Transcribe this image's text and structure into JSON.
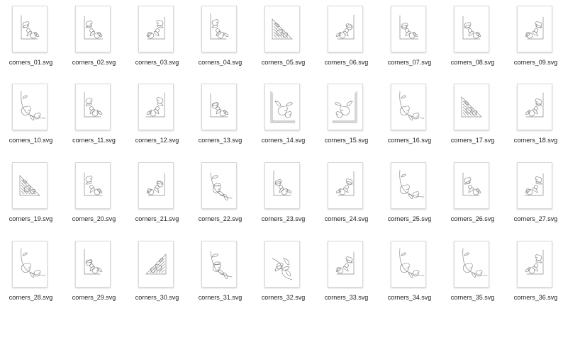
{
  "files": [
    {
      "name": "corners_01.svg",
      "icon": "floral-corner-ornament-icon"
    },
    {
      "name": "corners_02.svg",
      "icon": "floral-corner-ornament-icon"
    },
    {
      "name": "corners_03.svg",
      "icon": "floral-corner-ornament-icon"
    },
    {
      "name": "corners_04.svg",
      "icon": "floral-corner-ornament-icon"
    },
    {
      "name": "corners_05.svg",
      "icon": "lace-triangle-corner-icon"
    },
    {
      "name": "corners_06.svg",
      "icon": "floral-corner-ornament-icon"
    },
    {
      "name": "corners_07.svg",
      "icon": "floral-corner-ornament-icon"
    },
    {
      "name": "corners_08.svg",
      "icon": "floral-corner-ornament-icon"
    },
    {
      "name": "corners_09.svg",
      "icon": "floral-corner-ornament-icon"
    },
    {
      "name": "corners_10.svg",
      "icon": "scroll-corner-ornament-icon"
    },
    {
      "name": "corners_11.svg",
      "icon": "floral-corner-ornament-icon"
    },
    {
      "name": "corners_12.svg",
      "icon": "floral-corner-ornament-icon"
    },
    {
      "name": "corners_13.svg",
      "icon": "floral-corner-ornament-icon"
    },
    {
      "name": "corners_14.svg",
      "icon": "framed-corner-ornament-icon"
    },
    {
      "name": "corners_15.svg",
      "icon": "framed-corner-ornament-icon"
    },
    {
      "name": "corners_16.svg",
      "icon": "scroll-corner-ornament-icon"
    },
    {
      "name": "corners_17.svg",
      "icon": "lace-triangle-corner-icon"
    },
    {
      "name": "corners_18.svg",
      "icon": "floral-corner-ornament-icon"
    },
    {
      "name": "corners_19.svg",
      "icon": "lace-triangle-corner-icon"
    },
    {
      "name": "corners_20.svg",
      "icon": "floral-corner-ornament-icon"
    },
    {
      "name": "corners_21.svg",
      "icon": "floral-corner-ornament-icon"
    },
    {
      "name": "corners_22.svg",
      "icon": "acanthus-corner-ornament-icon"
    },
    {
      "name": "corners_23.svg",
      "icon": "floral-corner-ornament-icon"
    },
    {
      "name": "corners_24.svg",
      "icon": "floral-corner-ornament-icon"
    },
    {
      "name": "corners_25.svg",
      "icon": "scroll-corner-ornament-icon"
    },
    {
      "name": "corners_26.svg",
      "icon": "floral-corner-ornament-icon"
    },
    {
      "name": "corners_27.svg",
      "icon": "floral-corner-ornament-icon"
    },
    {
      "name": "corners_28.svg",
      "icon": "scroll-corner-ornament-icon"
    },
    {
      "name": "corners_29.svg",
      "icon": "floral-corner-ornament-icon"
    },
    {
      "name": "corners_30.svg",
      "icon": "lace-triangle-corner-icon"
    },
    {
      "name": "corners_31.svg",
      "icon": "acanthus-corner-ornament-icon"
    },
    {
      "name": "corners_32.svg",
      "icon": "fleur-corner-ornament-icon"
    },
    {
      "name": "corners_33.svg",
      "icon": "floral-corner-ornament-icon"
    },
    {
      "name": "corners_34.svg",
      "icon": "scroll-corner-ornament-icon"
    },
    {
      "name": "corners_35.svg",
      "icon": "scroll-corner-ornament-icon"
    },
    {
      "name": "corners_36.svg",
      "icon": "floral-corner-ornament-icon"
    }
  ],
  "colors": {
    "background": "#ffffff",
    "thumbnail_border": "#d9d9d9",
    "ornament_stroke": "#8a8a8a",
    "label_text": "#222222"
  }
}
